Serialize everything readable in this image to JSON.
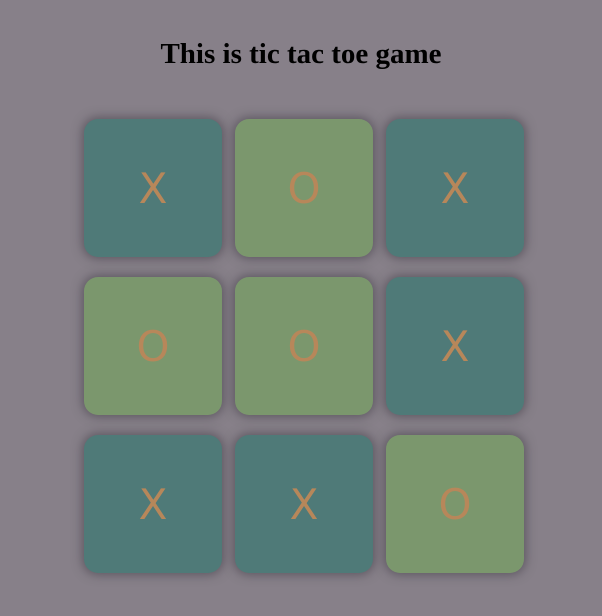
{
  "title": "This is tic tac toe game",
  "colors": {
    "background": "#878089",
    "x_cell": "#4f7a78",
    "o_cell": "#7b976d",
    "mark": "#b7875a"
  },
  "board": [
    "X",
    "O",
    "X",
    "O",
    "O",
    "X",
    "X",
    "X",
    "O"
  ]
}
